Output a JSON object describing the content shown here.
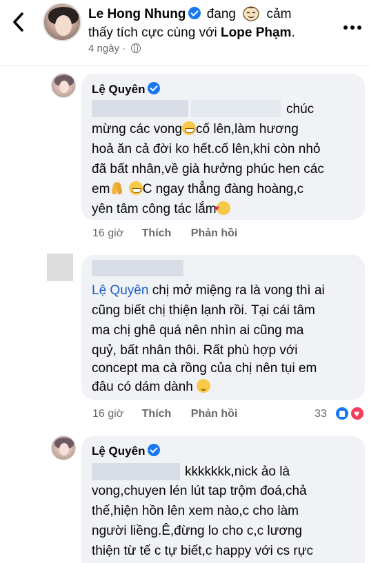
{
  "header": {
    "poster_name": "Le Hong Nhung",
    "status_prefix": "đang",
    "status_line1_end": "cảm",
    "status_line2_prefix": "thấy tích cực cùng với",
    "tagged_name": "Lope Phạm",
    "status_line2_suffix": ".",
    "time": "4 ngày",
    "dot": "·",
    "icons": {
      "back": "chevron-left-icon",
      "privacy": "globe-icon",
      "more": "more-dots-icon",
      "feeling": "emoji-face-icon"
    }
  },
  "comments": [
    {
      "author": "Lệ Quyên",
      "verified": true,
      "lines": [
        "chúc",
        "mừng các vong",
        "cố lên,làm hương",
        "hoả ăn cả đời ko hết.cố lên,khi còn nhỏ",
        "đã bất nhân,về già hưởng phúc hen các",
        "em",
        "C ngay thẳng đàng hoàng,c",
        "yên tâm công tác lắm"
      ],
      "emojis": [
        "grin-emoji",
        "pray-emoji",
        "grin-emoji",
        "hearts-emoji"
      ],
      "time": "16 giờ",
      "like_label": "Thích",
      "reply_label": "Phản hồi"
    },
    {
      "author": "",
      "mention": "Lệ Quyên",
      "lines": [
        "chị mở miệng ra là vong thì ai",
        "cũng biết chị thiện lạnh rồi. Tại cái tâm",
        "ma chị ghê quá nên nhìn ai cũng ma",
        "quỷ, bất nhân thôi. Rất phù hợp với",
        "concept ma cà rồng của chị nên tụi em",
        "đâu có dám dành"
      ],
      "emojis": [
        "relieved-emoji"
      ],
      "time": "16 giờ",
      "like_label": "Thích",
      "reply_label": "Phản hồi",
      "reaction_count": "33",
      "reactions": [
        "like-reaction",
        "love-reaction"
      ]
    },
    {
      "author": "Lệ Quyên",
      "verified": true,
      "lines": [
        "kkkkkkk,nick ảo là",
        "vong,chuyen lén lút tap trộm đoá,chả",
        "thế,hiện hồn lên xem nào,c cho làm",
        "người liềng.Ê,đừng lo cho c,c lương",
        "thiện từ tế c tự biết,c happy với cs rực"
      ]
    }
  ]
}
